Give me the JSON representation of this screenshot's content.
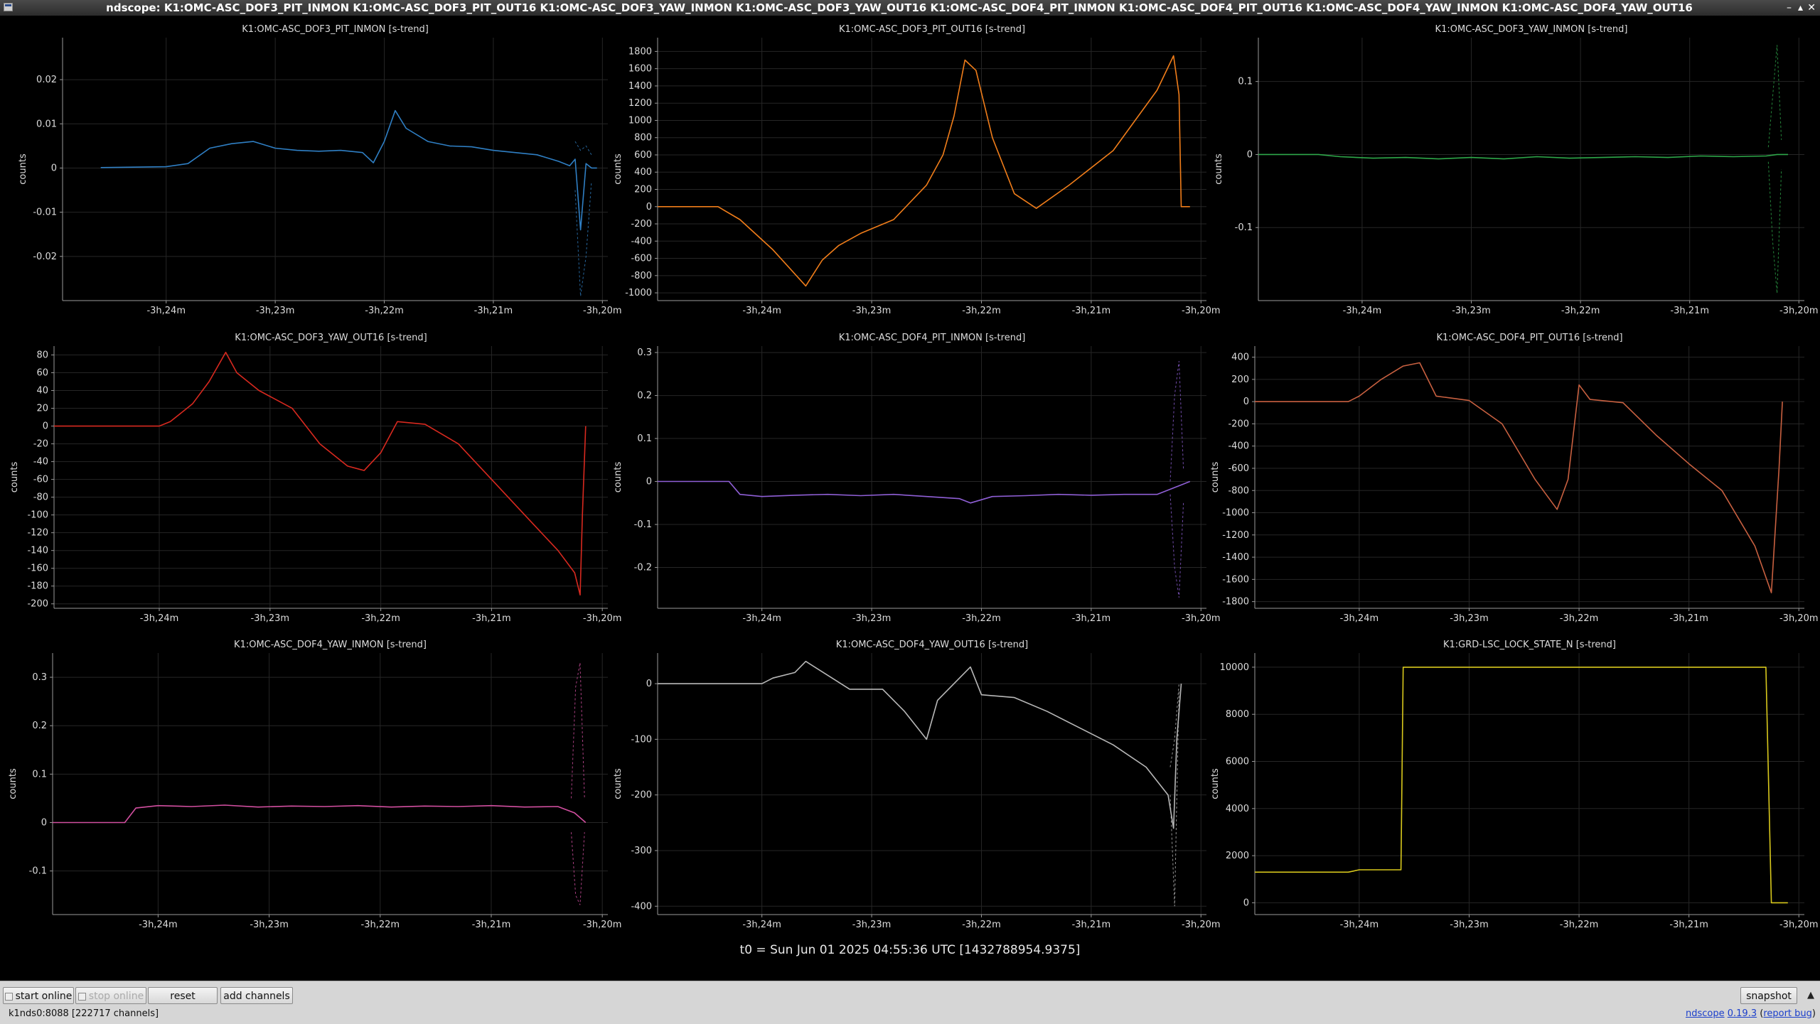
{
  "window": {
    "title": "ndscope: K1:OMC-ASC_DOF3_PIT_INMON K1:OMC-ASC_DOF3_PIT_OUT16 K1:OMC-ASC_DOF3_YAW_INMON K1:OMC-ASC_DOF3_YAW_OUT16 K1:OMC-ASC_DOF4_PIT_INMON K1:OMC-ASC_DOF4_PIT_OUT16 K1:OMC-ASC_DOF4_YAW_INMON K1:OMC-ASC_DOF4_YAW_OUT16",
    "controls": [
      "–",
      "▴",
      "✕"
    ]
  },
  "t0_label": "t0 = Sun Jun 01 2025 04:55:36 UTC [1432788954.9375]",
  "toolbar": {
    "start_online": "start online",
    "stop_online": "stop online",
    "reset": "reset",
    "add_channels": "add channels",
    "snapshot": "snapshot",
    "collapse": "▲"
  },
  "status": {
    "server": "k1nds0:8088  [222717 channels]",
    "app_name": "ndscope",
    "version": "0.19.3",
    "report_bug": "report bug"
  },
  "chart_data": [
    {
      "type": "line",
      "title": "K1:OMC-ASC_DOF3_PIT_INMON [s-trend]",
      "ylabel": "counts",
      "color": "#2f7fc4",
      "x_ticks": [
        "-3h,24m",
        "-3h,23m",
        "-3h,22m",
        "-3h,21m",
        "-3h,20m"
      ],
      "y_ticks": [
        -0.02,
        -0.01,
        0,
        0.01,
        0.02
      ],
      "y_tick_labels": [
        "-0.02",
        "-0.01",
        "0",
        "0.01",
        "0.02"
      ],
      "ylim": [
        -0.03,
        0.0295
      ],
      "x": [
        -24.6,
        -24.3,
        -24.0,
        -23.8,
        -23.6,
        -23.4,
        -23.2,
        -23.0,
        -22.8,
        -22.6,
        -22.4,
        -22.2,
        -22.1,
        -22.0,
        -21.9,
        -21.8,
        -21.6,
        -21.4,
        -21.2,
        -21.0,
        -20.8,
        -20.6,
        -20.4,
        -20.3,
        -20.25,
        -20.2,
        -20.15,
        -20.1,
        -20.05
      ],
      "y": [
        0.0001,
        0.0002,
        0.0003,
        0.001,
        0.0045,
        0.0055,
        0.006,
        0.0045,
        0.004,
        0.0038,
        0.004,
        0.0035,
        0.0012,
        0.006,
        0.013,
        0.009,
        0.006,
        0.005,
        0.0048,
        0.004,
        0.0035,
        0.003,
        0.0015,
        0.0005,
        0.002,
        -0.014,
        0.001,
        0.0,
        0.0
      ],
      "envelope_x": [
        -20.25,
        -20.2,
        -20.15,
        -20.1
      ],
      "envelope_min": [
        -0.005,
        -0.029,
        -0.02,
        -0.003
      ],
      "envelope_max": [
        0.006,
        0.004,
        0.005,
        0.003
      ]
    },
    {
      "type": "line",
      "title": "K1:OMC-ASC_DOF3_PIT_OUT16 [s-trend]",
      "ylabel": "counts",
      "color": "#f07d1a",
      "x_ticks": [
        "-3h,24m",
        "-3h,23m",
        "-3h,22m",
        "-3h,21m",
        "-3h,20m"
      ],
      "y_ticks": [
        -1000,
        -800,
        -600,
        -400,
        -200,
        0,
        200,
        400,
        600,
        800,
        1000,
        1200,
        1400,
        1600,
        1800
      ],
      "y_tick_labels": [
        "-1000",
        "-800",
        "-600",
        "-400",
        "-200",
        "0",
        "200",
        "400",
        "600",
        "800",
        "1000",
        "1200",
        "1400",
        "1600",
        "1800"
      ],
      "ylim": [
        -1090,
        1960
      ],
      "x": [
        -24.95,
        -24.4,
        -24.2,
        -23.9,
        -23.6,
        -23.45,
        -23.3,
        -23.1,
        -22.8,
        -22.5,
        -22.35,
        -22.25,
        -22.15,
        -22.05,
        -21.9,
        -21.7,
        -21.5,
        -21.2,
        -20.8,
        -20.4,
        -20.25,
        -20.2,
        -20.18,
        -20.1
      ],
      "y": [
        0,
        0,
        -150,
        -500,
        -920,
        -620,
        -450,
        -310,
        -150,
        250,
        600,
        1050,
        1700,
        1580,
        800,
        150,
        -20,
        250,
        650,
        1350,
        1750,
        1300,
        0,
        0
      ]
    },
    {
      "type": "line",
      "title": "K1:OMC-ASC_DOF3_YAW_INMON [s-trend]",
      "ylabel": "counts",
      "color": "#2ea84a",
      "x_ticks": [
        "-3h,24m",
        "-3h,23m",
        "-3h,22m",
        "-3h,21m",
        "-3h,20m"
      ],
      "y_ticks": [
        -0.1,
        0,
        0.1
      ],
      "y_tick_labels": [
        "-0.1",
        "0",
        "0.1"
      ],
      "ylim": [
        -0.2,
        0.16
      ],
      "x": [
        -24.95,
        -24.4,
        -24.2,
        -23.9,
        -23.6,
        -23.3,
        -23.0,
        -22.7,
        -22.4,
        -22.1,
        -21.8,
        -21.5,
        -21.2,
        -20.9,
        -20.6,
        -20.3,
        -20.2,
        -20.1
      ],
      "y": [
        0,
        0,
        -0.003,
        -0.005,
        -0.004,
        -0.006,
        -0.004,
        -0.006,
        -0.003,
        -0.005,
        -0.004,
        -0.003,
        -0.004,
        -0.002,
        -0.003,
        -0.002,
        0.0,
        0
      ],
      "envelope_x": [
        -20.28,
        -20.24,
        -20.2,
        -20.16
      ],
      "envelope_min": [
        -0.01,
        -0.12,
        -0.19,
        -0.02
      ],
      "envelope_max": [
        0.01,
        0.08,
        0.15,
        0.02
      ]
    },
    {
      "type": "line",
      "title": "K1:OMC-ASC_DOF3_YAW_OUT16 [s-trend]",
      "ylabel": "counts",
      "color": "#d8291f",
      "x_ticks": [
        "-3h,24m",
        "-3h,23m",
        "-3h,22m",
        "-3h,21m",
        "-3h,20m"
      ],
      "y_ticks": [
        -200,
        -180,
        -160,
        -140,
        -120,
        -100,
        -80,
        -60,
        -40,
        -20,
        0,
        20,
        40,
        60,
        80
      ],
      "y_tick_labels": [
        "-200",
        "-180",
        "-160",
        "-140",
        "-120",
        "-100",
        "-80",
        "-60",
        "-40",
        "-20",
        "0",
        "20",
        "40",
        "60",
        "80"
      ],
      "ylim": [
        -205,
        90
      ],
      "x": [
        -24.95,
        -24.0,
        -23.9,
        -23.7,
        -23.55,
        -23.4,
        -23.3,
        -23.1,
        -22.8,
        -22.55,
        -22.3,
        -22.15,
        -22.0,
        -21.85,
        -21.6,
        -21.3,
        -21.0,
        -20.7,
        -20.4,
        -20.25,
        -20.2,
        -20.18,
        -20.15
      ],
      "y": [
        0,
        0,
        5,
        25,
        50,
        83,
        60,
        40,
        20,
        -20,
        -45,
        -50,
        -30,
        5,
        2,
        -20,
        -60,
        -100,
        -140,
        -165,
        -190,
        -100,
        0
      ]
    },
    {
      "type": "line",
      "title": "K1:OMC-ASC_DOF4_PIT_INMON [s-trend]",
      "ylabel": "counts",
      "color": "#8f5fd6",
      "x_ticks": [
        "-3h,24m",
        "-3h,23m",
        "-3h,22m",
        "-3h,21m",
        "-3h,20m"
      ],
      "y_ticks": [
        -0.2,
        -0.1,
        0,
        0.1,
        0.2,
        0.3
      ],
      "y_tick_labels": [
        "-0.2",
        "-0.1",
        "0",
        "0.1",
        "0.2",
        "0.3"
      ],
      "ylim": [
        -0.295,
        0.315
      ],
      "x": [
        -24.95,
        -24.3,
        -24.2,
        -24.0,
        -23.7,
        -23.4,
        -23.1,
        -22.8,
        -22.5,
        -22.2,
        -22.1,
        -21.9,
        -21.6,
        -21.3,
        -21.0,
        -20.7,
        -20.4,
        -20.2,
        -20.1
      ],
      "y": [
        0,
        0,
        -0.03,
        -0.035,
        -0.032,
        -0.03,
        -0.033,
        -0.03,
        -0.035,
        -0.04,
        -0.05,
        -0.035,
        -0.033,
        -0.03,
        -0.032,
        -0.03,
        -0.03,
        -0.01,
        0
      ],
      "envelope_x": [
        -20.28,
        -20.24,
        -20.2,
        -20.16
      ],
      "envelope_min": [
        -0.03,
        -0.2,
        -0.27,
        -0.05
      ],
      "envelope_max": [
        0.0,
        0.2,
        0.28,
        0.03
      ]
    },
    {
      "type": "line",
      "title": "K1:OMC-ASC_DOF4_PIT_OUT16 [s-trend]",
      "ylabel": "counts",
      "color": "#c86040",
      "x_ticks": [
        "-3h,24m",
        "-3h,23m",
        "-3h,22m",
        "-3h,21m",
        "-3h,20m"
      ],
      "y_ticks": [
        -1800,
        -1600,
        -1400,
        -1200,
        -1000,
        -800,
        -600,
        -400,
        -200,
        0,
        200,
        400
      ],
      "y_tick_labels": [
        "-1800",
        "-1600",
        "-1400",
        "-1200",
        "-1000",
        "-800",
        "-600",
        "-400",
        "-200",
        "0",
        "200",
        "400"
      ],
      "ylim": [
        -1860,
        500
      ],
      "x": [
        -24.95,
        -24.1,
        -24.0,
        -23.8,
        -23.6,
        -23.45,
        -23.3,
        -23.0,
        -22.7,
        -22.4,
        -22.2,
        -22.1,
        -22.0,
        -21.9,
        -21.6,
        -21.3,
        -21.0,
        -20.7,
        -20.4,
        -20.25,
        -20.18,
        -20.15
      ],
      "y": [
        0,
        0,
        50,
        200,
        320,
        350,
        50,
        10,
        -200,
        -700,
        -970,
        -700,
        150,
        20,
        -10,
        -300,
        -560,
        -800,
        -1300,
        -1720,
        -600,
        0
      ]
    },
    {
      "type": "line",
      "title": "K1:OMC-ASC_DOF4_YAW_INMON [s-trend]",
      "ylabel": "counts",
      "color": "#d24fa0",
      "x_ticks": [
        "-3h,24m",
        "-3h,23m",
        "-3h,22m",
        "-3h,21m",
        "-3h,20m"
      ],
      "y_ticks": [
        -0.1,
        0,
        0.1,
        0.2,
        0.3
      ],
      "y_tick_labels": [
        "-0.1",
        "0",
        "0.1",
        "0.2",
        "0.3"
      ],
      "ylim": [
        -0.19,
        0.35
      ],
      "x": [
        -24.95,
        -24.3,
        -24.2,
        -24.0,
        -23.7,
        -23.4,
        -23.1,
        -22.8,
        -22.5,
        -22.2,
        -21.9,
        -21.6,
        -21.3,
        -21.0,
        -20.7,
        -20.4,
        -20.25,
        -20.15
      ],
      "y": [
        0,
        0,
        0.03,
        0.035,
        0.033,
        0.036,
        0.032,
        0.034,
        0.033,
        0.035,
        0.032,
        0.034,
        0.033,
        0.035,
        0.032,
        0.033,
        0.02,
        0
      ],
      "envelope_x": [
        -20.28,
        -20.24,
        -20.2,
        -20.16
      ],
      "envelope_min": [
        -0.02,
        -0.15,
        -0.17,
        -0.02
      ],
      "envelope_max": [
        0.05,
        0.28,
        0.33,
        0.05
      ]
    },
    {
      "type": "line",
      "title": "K1:OMC-ASC_DOF4_YAW_OUT16 [s-trend]",
      "ylabel": "counts",
      "color": "#b8b8b8",
      "x_ticks": [
        "-3h,24m",
        "-3h,23m",
        "-3h,22m",
        "-3h,21m",
        "-3h,20m"
      ],
      "y_ticks": [
        -400,
        -300,
        -200,
        -100,
        0
      ],
      "y_tick_labels": [
        "-400",
        "-300",
        "-200",
        "-100",
        "0"
      ],
      "ylim": [
        -415,
        55
      ],
      "x": [
        -24.95,
        -24.0,
        -23.9,
        -23.7,
        -23.6,
        -23.4,
        -23.2,
        -22.9,
        -22.7,
        -22.5,
        -22.4,
        -22.2,
        -22.1,
        -22.0,
        -21.7,
        -21.4,
        -21.1,
        -20.8,
        -20.5,
        -20.3,
        -20.25,
        -20.22,
        -20.18
      ],
      "y": [
        0,
        0,
        10,
        20,
        40,
        15,
        -10,
        -10,
        -50,
        -100,
        -30,
        10,
        30,
        -20,
        -25,
        -50,
        -80,
        -110,
        -150,
        -200,
        -260,
        -100,
        0
      ],
      "envelope_x": [
        -20.28,
        -20.24,
        -20.2
      ],
      "envelope_min": [
        -200,
        -400,
        -10
      ],
      "envelope_max": [
        -150,
        -100,
        0
      ]
    },
    {
      "type": "line",
      "title": "K1:GRD-LSC_LOCK_STATE_N [s-trend]",
      "ylabel": "counts",
      "color": "#d8c81c",
      "x_ticks": [
        "-3h,24m",
        "-3h,23m",
        "-3h,22m",
        "-3h,21m",
        "-3h,20m"
      ],
      "y_ticks": [
        0,
        2000,
        4000,
        6000,
        8000,
        10000
      ],
      "y_tick_labels": [
        "0",
        "2000",
        "4000",
        "6000",
        "8000",
        "10000"
      ],
      "ylim": [
        -500,
        10600
      ],
      "x": [
        -24.95,
        -24.1,
        -24.0,
        -23.62,
        -23.6,
        -20.3,
        -20.25,
        -20.2,
        -20.1
      ],
      "y": [
        1300,
        1300,
        1400,
        1400,
        10000,
        10000,
        0,
        0,
        0
      ]
    }
  ]
}
